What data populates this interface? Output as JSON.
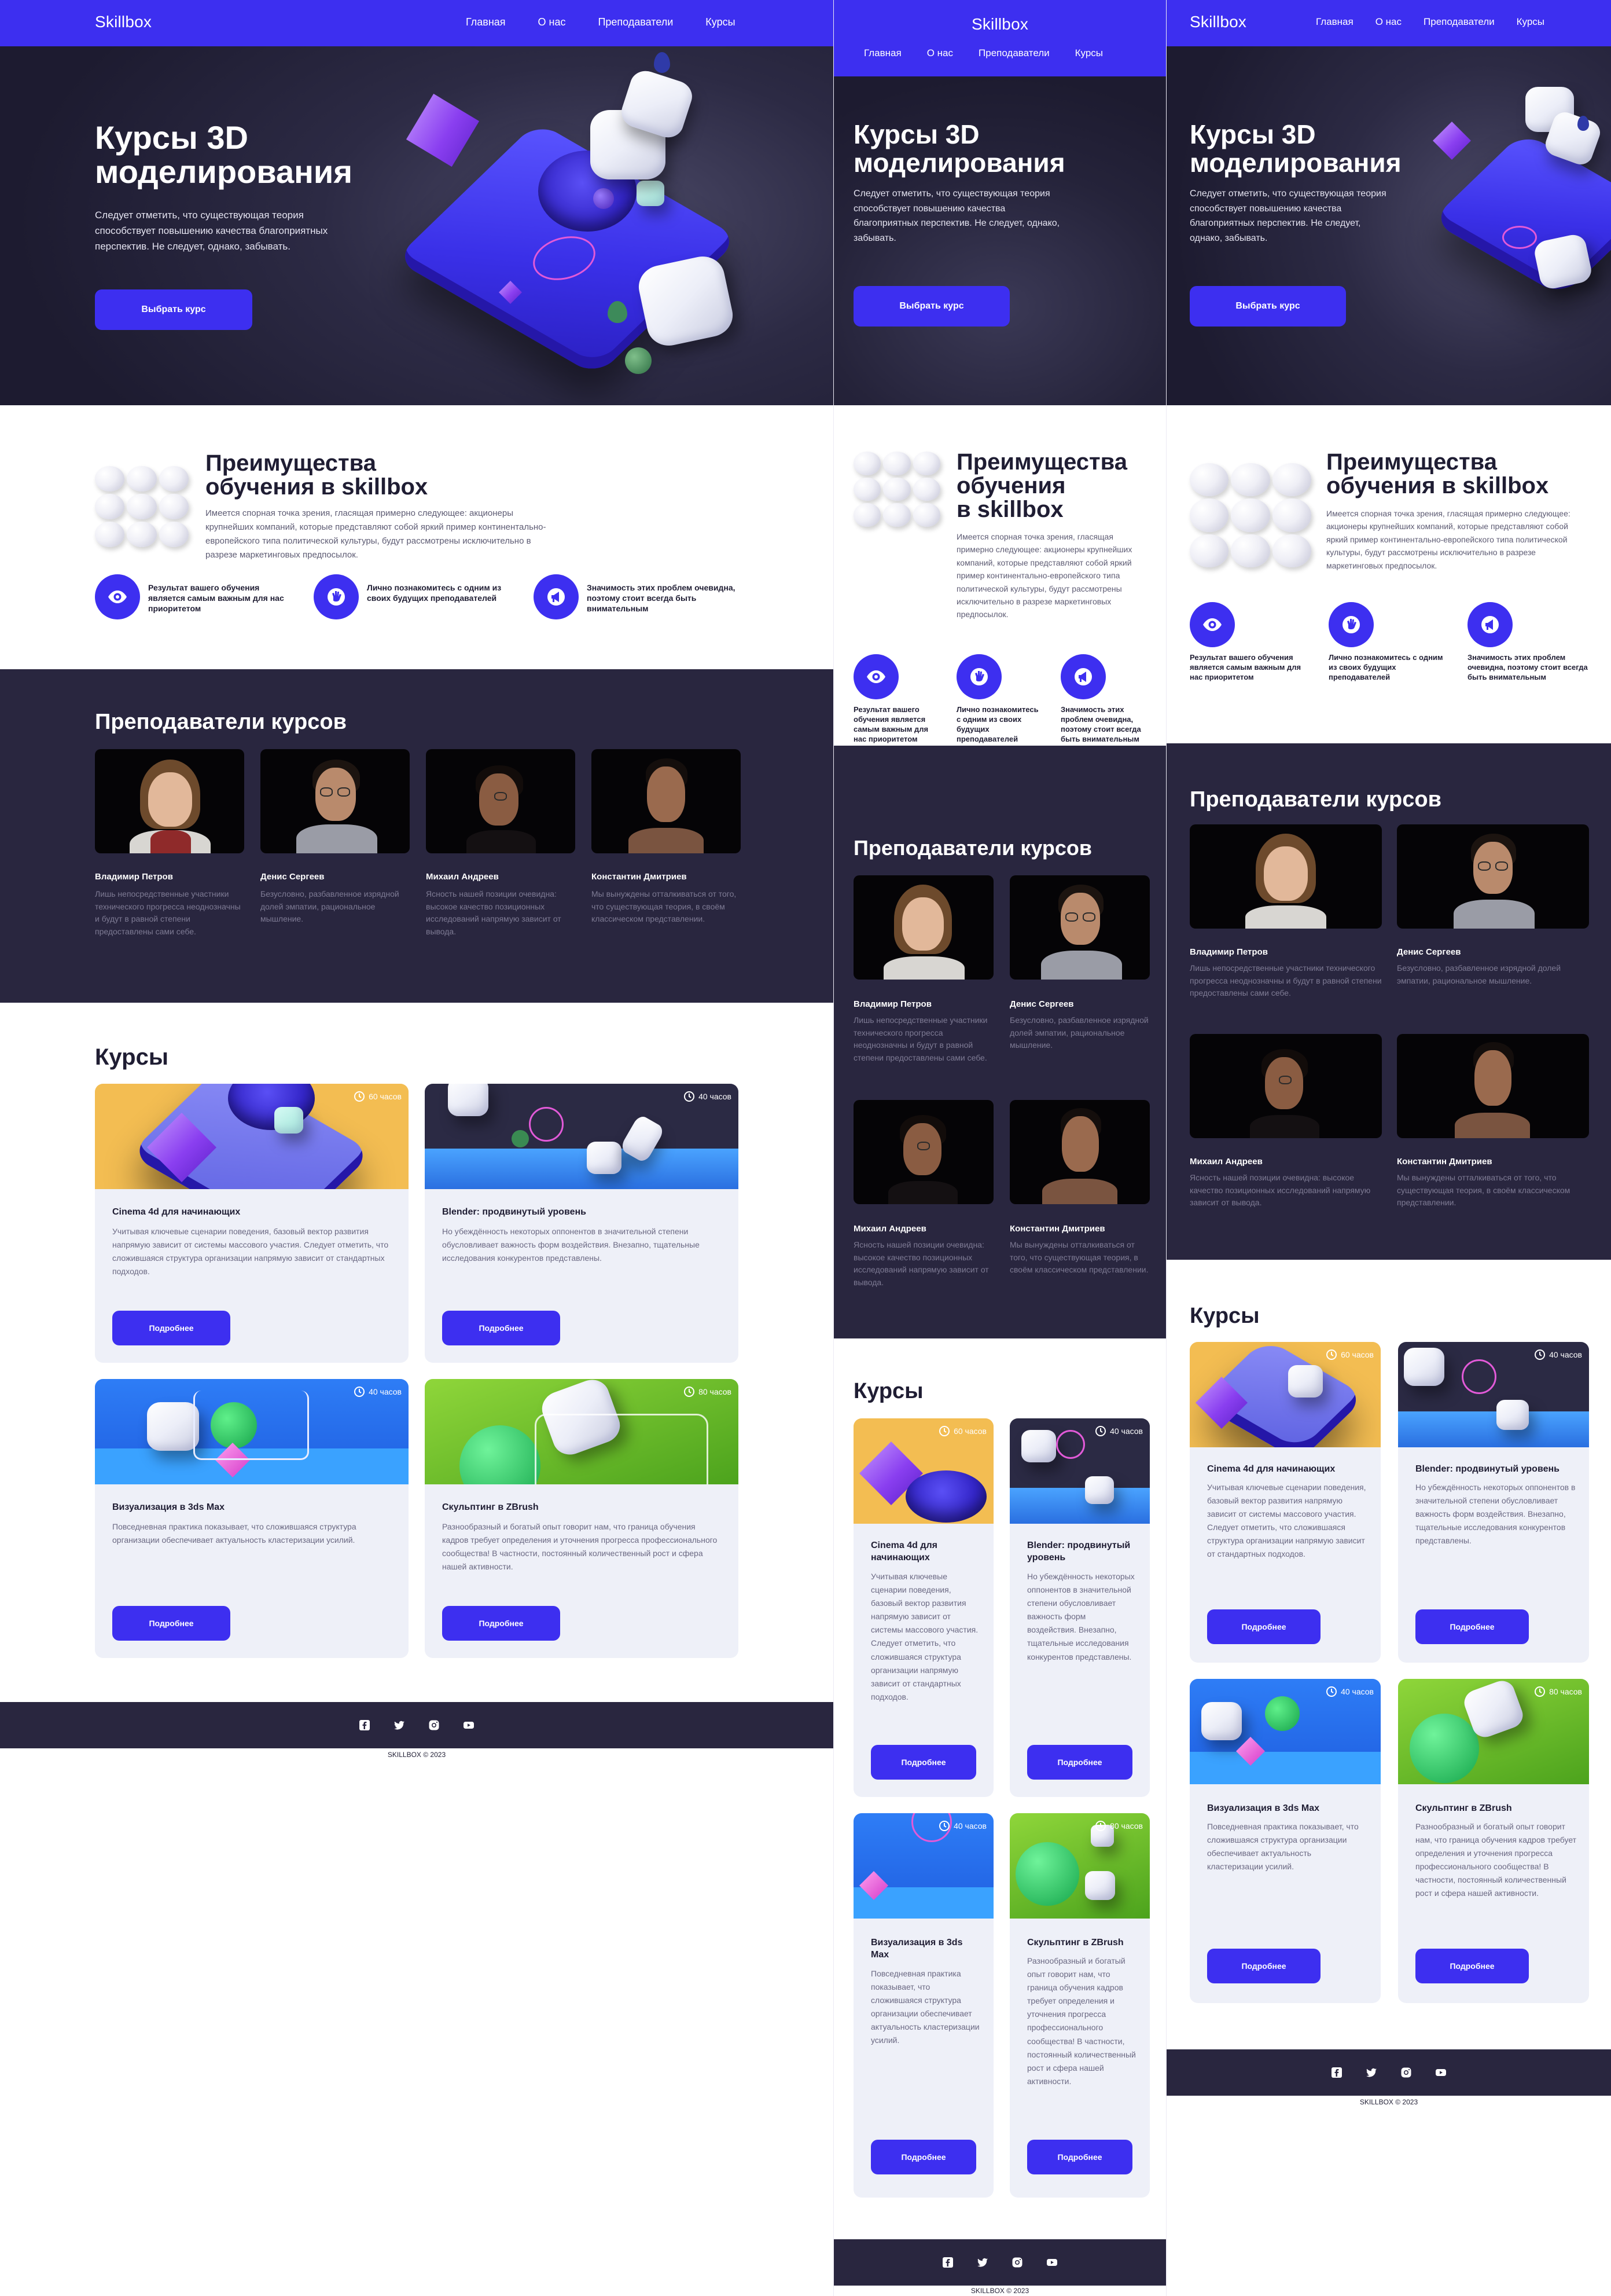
{
  "brand": {
    "logo": "Skillbox",
    "accent": "#3d2ff0",
    "dark": "#29263f"
  },
  "nav": [
    "Главная",
    "О нас",
    "Преподаватели",
    "Курсы"
  ],
  "hero": {
    "title_line1": "Курсы 3D",
    "title_line2": "моделирования",
    "text": "Следует отметить, что существующая теория способствует повышению качества благоприятных перспектив. Не следует, однако, забывать.",
    "button": "Выбрать курс"
  },
  "advantages": {
    "title": "Преимущества обучения в skillbox",
    "title_mobile_line1": "Преимущества",
    "title_mobile_line2": "обучения",
    "title_mobile_line3": "в skillbox",
    "text": "Имеется спорная точка зрения, гласящая примерно следующее: акционеры крупнейших компаний, которые представляют собой яркий пример континентально-европейского типа политической культуры, будут рассмотрены исключительно в разрезе маркетинговых предпосылок.",
    "features": [
      {
        "icon": "eye-icon",
        "text": "Результат вашего обучения является самым важным для нас приоритетом"
      },
      {
        "icon": "hand-icon",
        "text": "Лично познакомитесь с одним из своих будущих преподавателей"
      },
      {
        "icon": "megaphone-icon",
        "text": "Значимость этих проблем очевидна, поэтому стоит всегда быть внимательным"
      }
    ]
  },
  "teachers": {
    "title": "Преподаватели курсов",
    "items": [
      {
        "name": "Владимир Петров",
        "desc": "Лишь непосредственные участники технического прогресса неоднозначны и будут в равной степени предоставлены сами себе."
      },
      {
        "name": "Денис Сергеев",
        "desc": "Безусловно, разбавленное изрядной долей эмпатии, рациональное мышление."
      },
      {
        "name": "Михаил Андреев",
        "desc": "Ясность нашей позиции очевидна: высокое качество позиционных исследований напрямую зависит от вывода."
      },
      {
        "name": "Константин Дмитриев",
        "desc": "Мы вынуждены отталкиваться от того, что существующая теория, в своём классическом представлении."
      }
    ]
  },
  "courses": {
    "title": "Курсы",
    "more_label": "Подробнее",
    "items": [
      {
        "title": "Cinema 4d для начинающих",
        "hours": "60 часов",
        "desc": "Учитывая ключевые сценарии поведения, базовый вектор развития напрямую зависит от системы массового участия. Следует отметить, что сложившаяся структура организации напрямую зависит от стандартных подходов."
      },
      {
        "title": "Blender: продвинутый уровень",
        "hours": "40 часов",
        "desc": "Но убеждённость некоторых оппонентов в значительной степени обусловливает важность форм воздействия. Внезапно, тщательные исследования конкурентов представлены."
      },
      {
        "title": "Визуализация в 3ds Max",
        "hours": "40 часов",
        "desc": "Повседневная практика показывает, что сложившаяся структура организации обеспечивает актуальность кластеризации усилий."
      },
      {
        "title": "Скульптинг в ZBrush",
        "hours": "80 часов",
        "desc": "Разнообразный и богатый опыт говорит нам, что граница обучения кадров требует определения и уточнения прогресса профессионального сообщества! В частности, постоянный количественный рост и сфера нашей активности."
      }
    ]
  },
  "footer": {
    "social": [
      "facebook-icon",
      "twitter-icon",
      "instagram-icon",
      "youtube-icon"
    ],
    "copyright": "SKILLBOX © 2023"
  }
}
